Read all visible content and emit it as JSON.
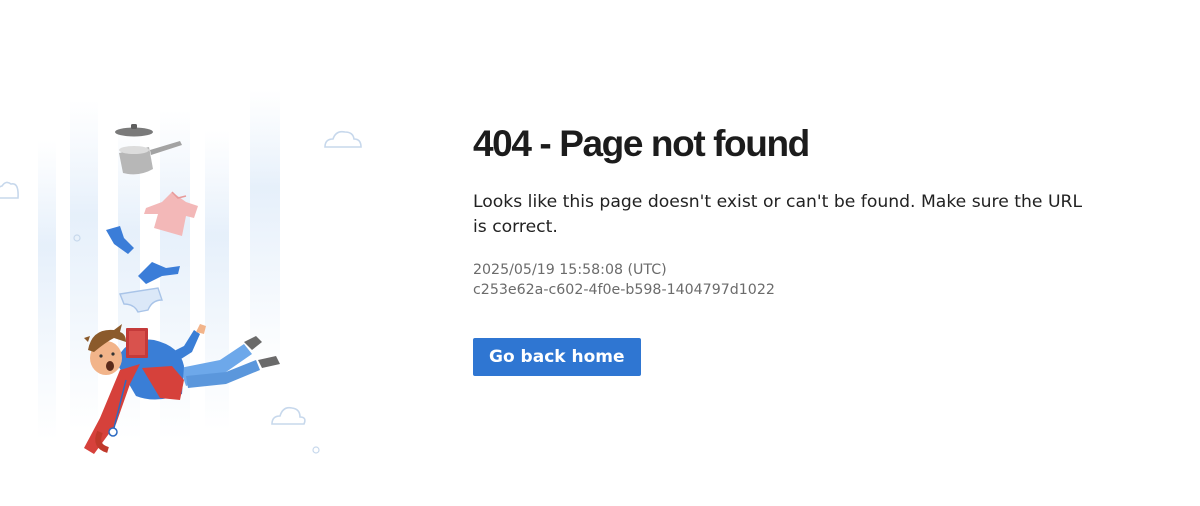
{
  "error": {
    "title": "404 - Page not found",
    "message": "Looks like this page doesn't exist or can't be found. Make sure the URL is correct.",
    "timestamp": "2025/05/19 15:58:08 (UTC)",
    "request_id": "c253e62a-c602-4f0e-b598-1404797d1022"
  },
  "actions": {
    "home_label": "Go back home"
  },
  "colors": {
    "accent": "#2f76d2",
    "title": "#1c1c1c",
    "meta": "#6b6b6b"
  },
  "illustration": {
    "icons": [
      "falling-man-illustration",
      "cooking-pot-icon",
      "pot-lid-icon",
      "shirt-icon",
      "sock-icon",
      "underwear-icon",
      "cloud-icon"
    ]
  }
}
